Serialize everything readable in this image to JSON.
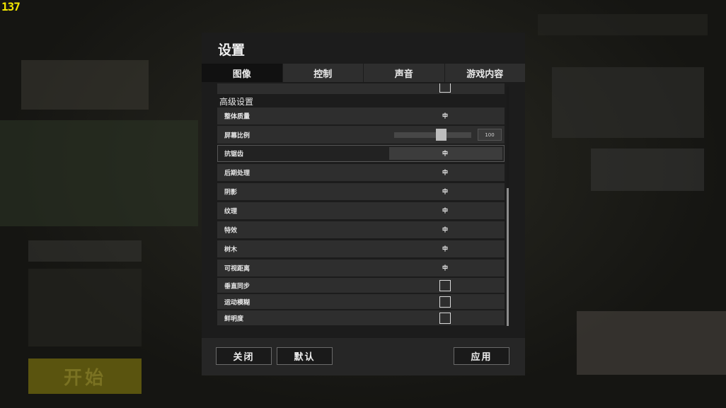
{
  "hud": {
    "fps": "137"
  },
  "background": {
    "start_button_label": "开始"
  },
  "dialog": {
    "title": "设置",
    "tabs": [
      {
        "label": "图像",
        "active": true
      },
      {
        "label": "控制",
        "active": false
      },
      {
        "label": "声音",
        "active": false
      },
      {
        "label": "游戏内容",
        "active": false
      }
    ],
    "section_title": "高级设置",
    "settings": [
      {
        "label": "整体质量",
        "type": "value",
        "value": "中"
      },
      {
        "label": "屏幕比例",
        "type": "slider",
        "value": "100"
      },
      {
        "label": "抗锯齿",
        "type": "value",
        "value": "中",
        "highlighted": true
      },
      {
        "label": "后期处理",
        "type": "value",
        "value": "中"
      },
      {
        "label": "阴影",
        "type": "value",
        "value": "中"
      },
      {
        "label": "纹理",
        "type": "value",
        "value": "中"
      },
      {
        "label": "特效",
        "type": "value",
        "value": "中"
      },
      {
        "label": "树木",
        "type": "value",
        "value": "中"
      },
      {
        "label": "可视距离",
        "type": "value",
        "value": "中"
      },
      {
        "label": "垂直同步",
        "type": "checkbox",
        "checked": false
      },
      {
        "label": "运动模糊",
        "type": "checkbox",
        "checked": false
      },
      {
        "label": "鲜明度",
        "type": "checkbox",
        "checked": false
      }
    ],
    "buttons": {
      "close": "关闭",
      "default": "默认",
      "apply": "应用"
    }
  },
  "colors": {
    "fps": "#f2e600",
    "dialog_bg": "#1c1c1c",
    "row_bg": "#2e2e2e",
    "active_tab": "#111111"
  }
}
